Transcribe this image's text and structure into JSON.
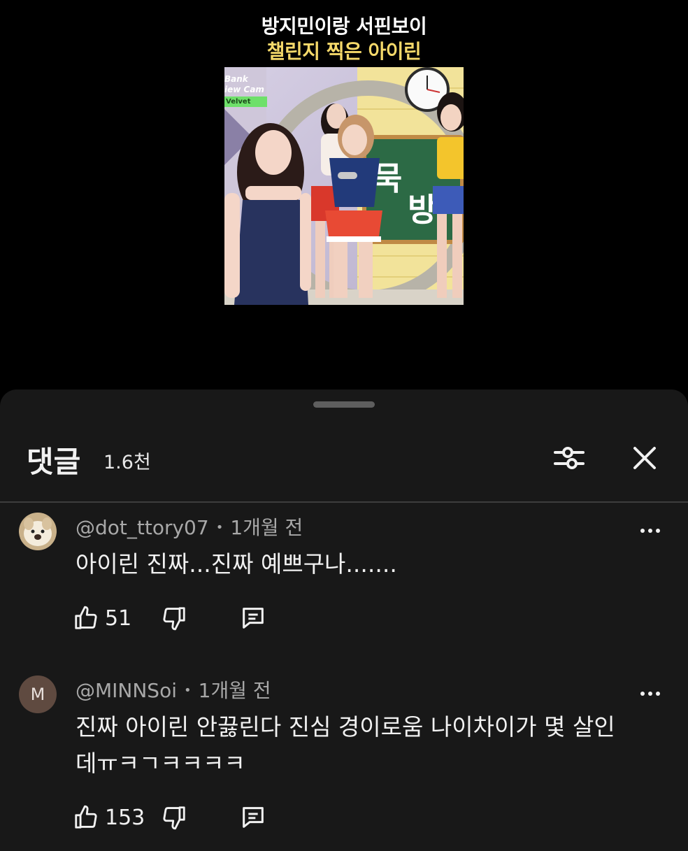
{
  "video": {
    "title_line1": "방지민이랑 서핀보이",
    "title_line2": "챌린지 찍은 아이린",
    "stamp_line1": "Bank",
    "stamp_line2": "iew Cam",
    "stamp_line3": "Velvet"
  },
  "comments_sheet": {
    "title": "댓글",
    "count": "1.6천",
    "filter_icon": "sliders-icon",
    "close_icon": "close-icon"
  },
  "comments": [
    {
      "handle": "@dot_ttory07",
      "time": "1개월 전",
      "text": "아이린 진짜...진짜 예쁘구나.......",
      "likes": "51",
      "avatar": "dog-photo"
    },
    {
      "handle": "@MINNSoi",
      "time": "1개월 전",
      "text": "진짜 아이린 안끓린다 진심 경이로움 나이차이가 몇 살인데ㅠㅋㄱㅋㅋㅋㅋ",
      "likes": "153",
      "avatar_letter": "M"
    }
  ],
  "colors": {
    "sheet_bg": "#181818",
    "title_yellow": "#f5d96a",
    "muted": "#a8a8a8"
  }
}
